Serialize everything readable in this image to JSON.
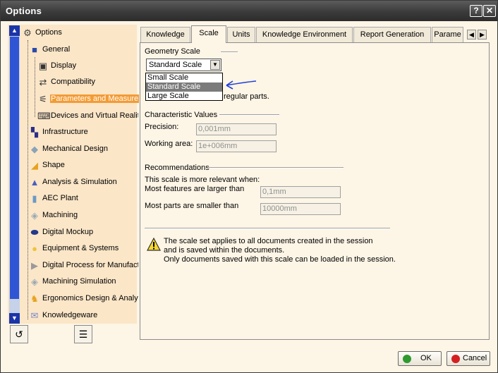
{
  "window": {
    "title": "Options",
    "help_glyph": "?",
    "close_glyph": "✕"
  },
  "tree": {
    "root": {
      "label": "Options"
    },
    "items": [
      {
        "label": "General"
      },
      {
        "label": "Display"
      },
      {
        "label": "Compatibility"
      },
      {
        "label": "Parameters and Measure"
      },
      {
        "label": "Devices and Virtual Realit"
      },
      {
        "label": "Infrastructure"
      },
      {
        "label": "Mechanical Design"
      },
      {
        "label": "Shape"
      },
      {
        "label": "Analysis & Simulation"
      },
      {
        "label": "AEC Plant"
      },
      {
        "label": "Machining"
      },
      {
        "label": "Digital Mockup"
      },
      {
        "label": "Equipment & Systems"
      },
      {
        "label": "Digital Process for Manufact"
      },
      {
        "label": "Machining Simulation"
      },
      {
        "label": "Ergonomics Design & Analys"
      },
      {
        "label": "Knowledgeware"
      }
    ],
    "selected": "Parameters and Measure"
  },
  "tabs": [
    {
      "label": "Knowledge"
    },
    {
      "label": "Scale"
    },
    {
      "label": "Units"
    },
    {
      "label": "Knowledge Environment"
    },
    {
      "label": "Report Generation"
    },
    {
      "label": "Parame"
    }
  ],
  "active_tab": "Scale",
  "geometry_scale": {
    "title": "Geometry Scale",
    "selected": "Standard Scale",
    "options": [
      "Small Scale",
      "Standard Scale",
      "Large Scale"
    ],
    "description_tail": "regular parts."
  },
  "characteristic_values": {
    "title": "Characteristic Values",
    "precision_label": "Precision:",
    "precision_value": "0,001mm",
    "working_area_label": "Working area:",
    "working_area_value": "1e+006mm"
  },
  "recommendations": {
    "title": "Recommendations",
    "intro": "This scale is more relevant when:",
    "features_label": "Most features are larger than",
    "features_value": "0,1mm",
    "parts_label": "Most parts are smaller than",
    "parts_value": "10000mm"
  },
  "notice": {
    "line1": "The scale set applies to all documents created in the session",
    "line2": "and is saved within the documents.",
    "line3": "Only documents saved with this scale can be loaded in the session."
  },
  "buttons": {
    "ok": "OK",
    "cancel": "Cancel"
  },
  "colors": {
    "accent_selected": "#f39b35",
    "ok_dot": "#2e9a2e",
    "cancel_dot": "#d42020",
    "annotation_arrow": "#1f3fd8"
  }
}
